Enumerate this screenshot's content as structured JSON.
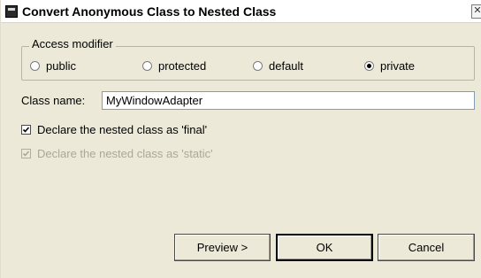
{
  "window": {
    "title": "Convert Anonymous Class to Nested Class",
    "close_glyph": "✕"
  },
  "access_modifier": {
    "legend": "Access modifier",
    "options": [
      {
        "label": "public",
        "selected": false
      },
      {
        "label": "protected",
        "selected": false
      },
      {
        "label": "default",
        "selected": false
      },
      {
        "label": "private",
        "selected": true
      }
    ]
  },
  "class_name": {
    "label": "Class name:",
    "value": "MyWindowAdapter"
  },
  "options": {
    "final_label": "Declare the nested class as 'final'",
    "final_checked": true,
    "static_label": "Declare the nested class as 'static'",
    "static_checked": true,
    "static_enabled": false
  },
  "buttons": {
    "preview": "Preview >",
    "ok": "OK",
    "cancel": "Cancel"
  },
  "icons": {
    "title": "eclipse-window-icon",
    "close": "close-icon",
    "check": "checkmark-icon"
  },
  "colors": {
    "dialog_bg": "#ece9d8",
    "field_border": "#7f9db9",
    "disabled_text": "#aca899"
  }
}
